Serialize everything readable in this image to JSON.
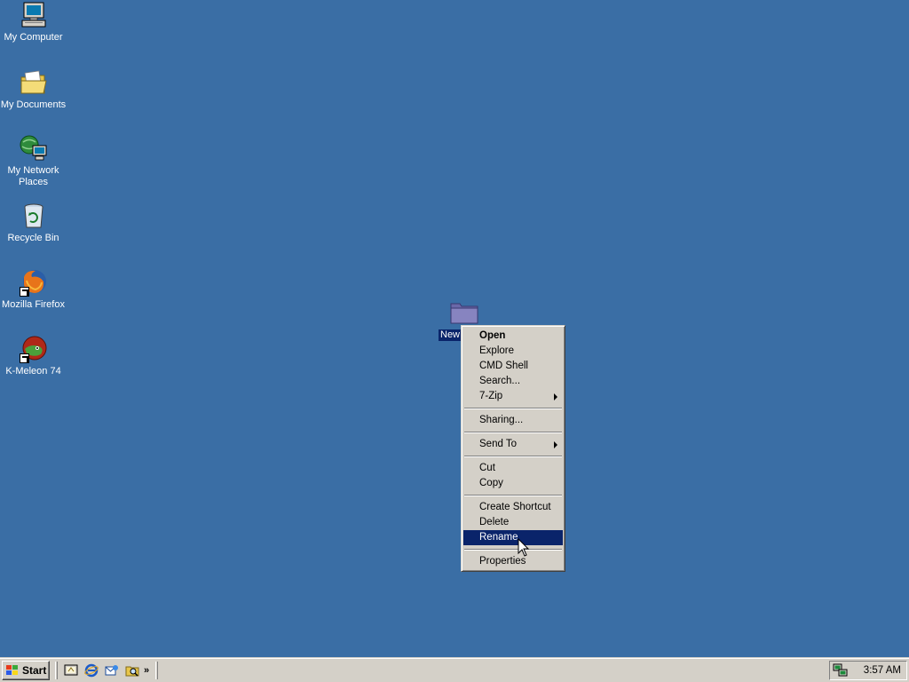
{
  "desktop": {
    "background_color": "#3a6ea5",
    "icons": [
      {
        "label": "My Computer",
        "icon": "computer-icon"
      },
      {
        "label": "My Documents",
        "icon": "documents-folder-icon"
      },
      {
        "label": "My Network Places",
        "icon": "network-places-icon"
      },
      {
        "label": "Recycle Bin",
        "icon": "recycle-bin-icon"
      },
      {
        "label": "Mozilla Firefox",
        "icon": "firefox-icon"
      },
      {
        "label": "K-Meleon 74",
        "icon": "k-meleon-icon"
      }
    ],
    "selected_item": {
      "label": "New",
      "icon": "folder-icon"
    }
  },
  "context_menu": {
    "items": {
      "open": "Open",
      "explore": "Explore",
      "cmd_shell": "CMD Shell",
      "search": "Search...",
      "seven_zip": "7-Zip",
      "sharing": "Sharing...",
      "send_to": "Send To",
      "cut": "Cut",
      "copy": "Copy",
      "create_shortcut": "Create Shortcut",
      "delete": "Delete",
      "rename": "Rename",
      "properties": "Properties"
    },
    "highlighted": "Rename",
    "highlight_color": "#0a246a"
  },
  "taskbar": {
    "start_label": "Start",
    "quick_launch_icons": [
      "show-desktop-icon",
      "internet-explorer-icon",
      "outlook-express-icon",
      "windows-explorer-icon"
    ],
    "chevron": "»",
    "tray_icon": "network-connection-icon",
    "clock": "3:57 AM"
  }
}
